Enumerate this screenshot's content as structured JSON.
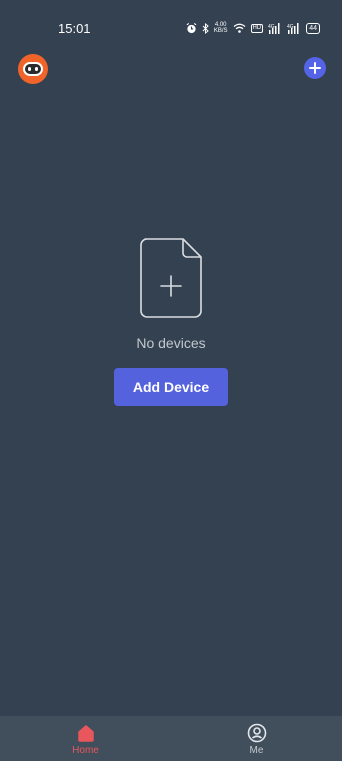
{
  "status_bar": {
    "time": "15:01",
    "speed_value": "4.00",
    "speed_unit": "KB/S",
    "hd_label": "HD",
    "signal1_label": "4G",
    "signal2_label": "4G",
    "battery": "44"
  },
  "header": {
    "avatar_icon": "robot-avatar-icon",
    "add_icon": "plus-icon"
  },
  "empty_state": {
    "icon": "file-add-icon",
    "message": "No devices",
    "button_label": "Add Device"
  },
  "tabs": [
    {
      "label": "Home",
      "icon": "home-icon",
      "active": true
    },
    {
      "label": "Me",
      "icon": "user-circle-icon",
      "active": false
    }
  ],
  "colors": {
    "background": "#344150",
    "accent": "#5462dd",
    "tab_active": "#e8575c",
    "tab_inactive": "#c3c8cf",
    "tab_bar": "#414e5c",
    "avatar": "#f0642a"
  }
}
